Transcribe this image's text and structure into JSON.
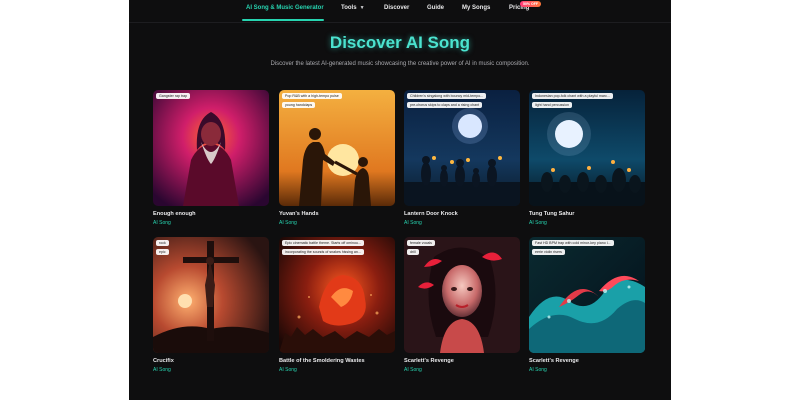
{
  "nav": {
    "items": [
      {
        "label": "AI Song & Music Generator",
        "active": true
      },
      {
        "label": "Tools",
        "dropdown": true
      },
      {
        "label": "Discover"
      },
      {
        "label": "Guide"
      },
      {
        "label": "My Songs"
      },
      {
        "label": "Pricing",
        "badge": "50% OFF"
      }
    ],
    "accent": "#27d4b0"
  },
  "hero": {
    "title": "Discover AI Song",
    "subtitle": "Discover the latest AI-generated music showcasing the creative power of AI in music composition."
  },
  "cards": [
    {
      "title": "Enough enough",
      "sub": "AI Song",
      "tags": [
        "Gangster rap trap"
      ]
    },
    {
      "title": "Yuvan's Hands",
      "sub": "AI Song",
      "tags": [
        "Pop R&B with a high-tempo pulse",
        "young handclaps"
      ]
    },
    {
      "title": "Lantern Door Knock",
      "sub": "AI Song",
      "tags": [
        "Children's singalong with bouncy mid-tempo...",
        "pre-chorus skips to claps and a rising chant"
      ]
    },
    {
      "title": "Tung Tung Sahur",
      "sub": "AI Song",
      "tags": [
        "Indonesian pop-folk chant with a playful marc...",
        "light hand percussion"
      ]
    },
    {
      "title": "Crucifix",
      "sub": "AI Song",
      "tags": [
        "rock",
        "epic"
      ]
    },
    {
      "title": "Battle of the Smoldering Wastes",
      "sub": "AI Song",
      "tags": [
        "Epic cinematic battle theme. Starts off ominou...",
        "incorporating the sounds of snakes hissing an..."
      ]
    },
    {
      "title": "Scarlett's Revenge",
      "sub": "AI Song",
      "tags": [
        "female vocals",
        "drill"
      ]
    },
    {
      "title": "Scarlett's Revenge",
      "sub": "AI Song",
      "tags": [
        "Fast HD BPM trap with cold minor-key piano l...",
        "eerie violin risers"
      ]
    }
  ]
}
